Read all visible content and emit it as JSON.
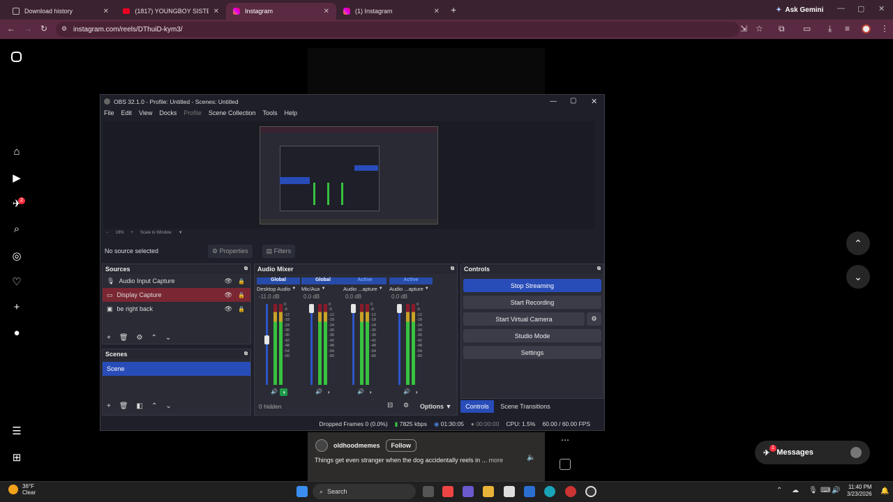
{
  "browser": {
    "tabs": [
      {
        "title": "Download history",
        "icon": "download-icon"
      },
      {
        "title": "(1817) YOUNGBOY SISTER - Yo",
        "icon": "youtube-icon"
      },
      {
        "title": "Instagram",
        "icon": "instagram-icon"
      },
      {
        "title": "(1) Instagram",
        "icon": "instagram-icon"
      }
    ],
    "ask_gemini": "Ask Gemini",
    "url": "instagram.com/reels/DThuiD-kym3/"
  },
  "instagram": {
    "notifications_badge": "2",
    "reel": {
      "username": "oldhoodmemes",
      "follow": "Follow",
      "caption": "Things get even stranger when the dog accidentally reels in ...",
      "more": "more"
    },
    "messages": {
      "label": "Messages",
      "badge": "1"
    }
  },
  "obs": {
    "title": "OBS 32.1.0 - Profile: Untitled - Scenes: Untitled",
    "menu": [
      "File",
      "Edit",
      "View",
      "Docks",
      "Profile",
      "Scene Collection",
      "Tools",
      "Help"
    ],
    "zoom": "19%",
    "scale_mode": "Scale to Window",
    "no_source": "No source selected",
    "properties": "Properties",
    "filters": "Filters",
    "sources_title": "Sources",
    "sources": [
      {
        "name": "Audio Input Capture"
      },
      {
        "name": "Display Capture"
      },
      {
        "name": "be right back"
      }
    ],
    "scenes_title": "Scenes",
    "scenes": [
      "Scene"
    ],
    "mixer_title": "Audio Mixer",
    "mixer": [
      {
        "scope": "Global",
        "name": "Desktop Audio",
        "db": "-11.0 dB",
        "level": 0.56
      },
      {
        "scope": "Global",
        "name": "Mic/Aux",
        "db": "0.0 dB",
        "level": 1.0
      },
      {
        "scope": "Active",
        "name": "Audio ...apture",
        "db": "0.0 dB",
        "level": 1.0
      },
      {
        "scope": "Active",
        "name": "Audio ...apture",
        "db": "0.0 dB",
        "level": 1.0
      }
    ],
    "meter_ticks": [
      "0",
      "-6",
      "-12",
      "-18",
      "-24",
      "-30",
      "-36",
      "-42",
      "-48",
      "-54",
      "-60"
    ],
    "hidden": "0 hidden",
    "options": "Options",
    "controls_title": "Controls",
    "controls": [
      "Stop Streaming",
      "Start Recording",
      "Start Virtual Camera",
      "Studio Mode",
      "Settings"
    ],
    "bottom_tabs": [
      "Controls",
      "Scene Transitions"
    ],
    "status": {
      "dropped": "Dropped Frames 0 (0.0%)",
      "bitrate": "7825 kbps",
      "stream_time": "01:30:05",
      "rec_time": "00:00:00",
      "cpu": "CPU: 1.5%",
      "fps": "60.00 / 60.00 FPS"
    }
  },
  "taskbar": {
    "weather_temp": "36°F",
    "weather_desc": "Clear",
    "search": "Search",
    "time": "11:40 PM",
    "date": "3/23/2026"
  }
}
